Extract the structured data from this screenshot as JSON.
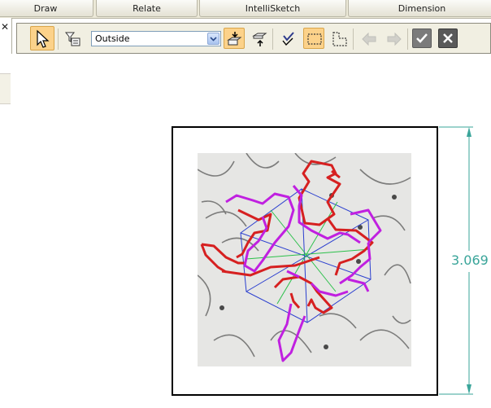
{
  "tabs": [
    {
      "label": "Draw"
    },
    {
      "label": "Relate"
    },
    {
      "label": "IntelliSketch"
    },
    {
      "label": "Dimension"
    }
  ],
  "toolbar": {
    "selection_filter": {
      "value": "Outside"
    },
    "icons": {
      "select": "arrow-cursor-icon",
      "filter": "filter-list-icon",
      "bring_forward": "bring-forward-icon",
      "send_backward": "send-backward-icon",
      "check_select": "checked-select-icon",
      "rect_select": "rectangle-select-icon",
      "poly_select": "polygon-select-icon",
      "back": "arrow-left-icon",
      "forward": "arrow-right-icon",
      "accept": "checkmark-icon",
      "cancel": "close-icon"
    }
  },
  "dimension": {
    "label": "3.069"
  },
  "colors": {
    "accent_active": "#fcd28a",
    "dimension": "#3aa59a",
    "outline_red": "#d62020",
    "outline_magenta": "#c020e0",
    "construction_blue": "#2b3fcf",
    "construction_green": "#2bc04a"
  }
}
